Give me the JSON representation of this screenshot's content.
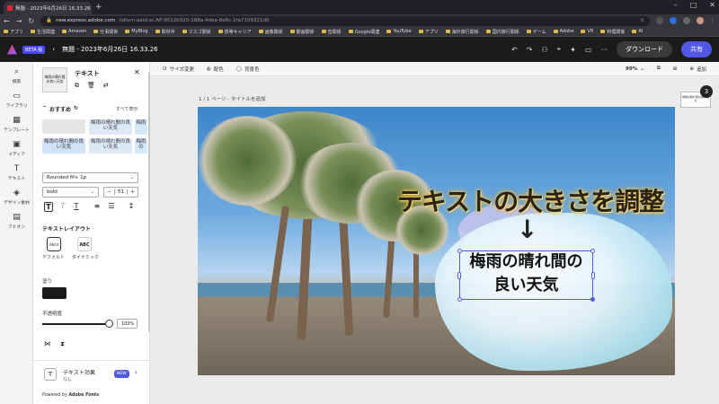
{
  "browser": {
    "tab_title": "無題 - 2023年6月26日 16.33.26",
    "url_host": "new.express.adobe.com",
    "url_path": "/id/urn:aaid:sc:AP:9512b920-188a-4dea-8e6c-1fa7109321d0",
    "bookmarks": [
      "アプリ",
      "生活関連",
      "Amazon",
      "仕事関係",
      "MyBlog",
      "取材中",
      "マスゴ関係",
      "技等キャリア",
      "画像関係",
      "動画関係",
      "音関係",
      "Google関連",
      "YouTube",
      "アプリ",
      "海外旅行関係",
      "国内旅行関係",
      "ゲーム",
      "Adobe",
      "VR",
      "料理関係",
      "AI"
    ]
  },
  "app": {
    "beta_label": "BETA 版",
    "doc_title": "無題 - 2023年6月26日 16.33.26",
    "download_label": "ダウンロード",
    "share_label": "共有"
  },
  "rail": {
    "items": [
      {
        "label": "検索",
        "icon": "search-icon"
      },
      {
        "label": "ライブラリ",
        "icon": "folder-icon"
      },
      {
        "label": "テンプレート",
        "icon": "template-icon"
      },
      {
        "label": "メディア",
        "icon": "media-icon"
      },
      {
        "label": "テキスト",
        "icon": "text-icon"
      },
      {
        "label": "デザイン素材",
        "icon": "shapes-icon"
      },
      {
        "label": "アドオン",
        "icon": "addon-icon"
      }
    ]
  },
  "panel": {
    "title": "テキスト",
    "thumb_text": "梅雨の晴れ間の良い天気",
    "recommend_label": "おすすめ",
    "show_all_label": "すべて表示",
    "chips": [
      "梅雨の晴れ間の良い天気",
      "梅雨",
      "梅雨の晴れ間の良い天気",
      "梅雨の晴れ間の良い天気",
      "梅雨の"
    ],
    "font_name": "Rounded M+ 1p",
    "font_weight": "bold",
    "font_size": "51",
    "layout_label": "テキストレイアウト",
    "layout_default_label": "デフォルト",
    "layout_dynamic_label": "ダイナミック",
    "layout_default_icon_text": "Abcd",
    "layout_dynamic_icon_text": "ABC",
    "fill_label": "塗り",
    "fill_color": "#1a1a1a",
    "opacity_label": "不透明度",
    "opacity_value": "100%",
    "opacity_level": 1.0,
    "effect_title": "テキスト効果",
    "effect_value": "なし",
    "new_badge": "NEW",
    "powered_by": "Powered by ",
    "powered_brand": "Adobe Fonts"
  },
  "canvas": {
    "toolbar": {
      "resize_label": "サイズ変更",
      "color_label": "配色",
      "bg_label": "背景色",
      "zoom": "99%",
      "add_label": "追加"
    },
    "page_info": "1 / 1 ページ - タイトルを追加",
    "headline": "テキストの大きさを調整",
    "arrow": "↓",
    "main_line1": "梅雨の晴れ間の",
    "main_line2": "良い天気",
    "page_count": "3",
    "mini_preview_text": "梅雨の晴れ間の良い天気"
  }
}
